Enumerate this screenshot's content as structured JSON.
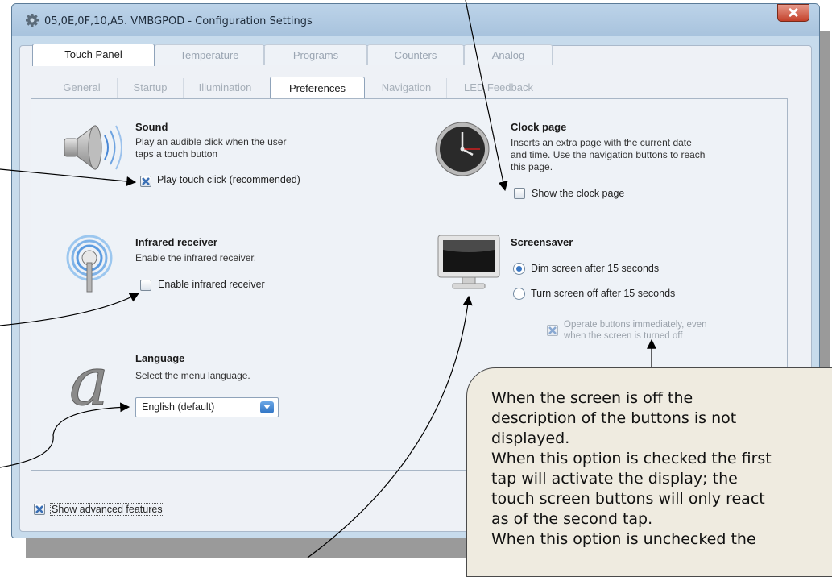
{
  "window": {
    "title": "05,0E,0F,10,A5. VMBGPOD - Configuration Settings"
  },
  "tabs": [
    {
      "label": "Touch Panel",
      "active": true
    },
    {
      "label": "Temperature",
      "active": false
    },
    {
      "label": "Programs",
      "active": false
    },
    {
      "label": "Counters",
      "active": false
    },
    {
      "label": "Analog",
      "active": false
    }
  ],
  "subtabs": [
    {
      "label": "General",
      "active": false
    },
    {
      "label": "Startup",
      "active": false
    },
    {
      "label": "Illumination",
      "active": false
    },
    {
      "label": "Preferences",
      "active": true
    },
    {
      "label": "Navigation",
      "active": false
    },
    {
      "label": "LED Feedback",
      "active": false
    }
  ],
  "sound": {
    "heading": "Sound",
    "description_line1": "Play an audible click when the user",
    "description_line2": "taps a touch button",
    "checkbox_label": "Play touch click (recommended)",
    "checked": true
  },
  "infrared": {
    "heading": "Infrared receiver",
    "description": "Enable the infrared receiver.",
    "checkbox_label": "Enable infrared receiver",
    "checked": false
  },
  "language": {
    "heading": "Language",
    "description": "Select the menu language.",
    "selected": "English (default)"
  },
  "clock": {
    "heading": "Clock page",
    "description_line1": "Inserts an extra page with the current date",
    "description_line2": "and time. Use the navigation buttons to reach",
    "description_line3": "this page.",
    "checkbox_label": "Show the clock page",
    "checked": false
  },
  "screensaver": {
    "heading": "Screensaver",
    "option_dim": "Dim screen after 15 seconds",
    "option_off": "Turn screen off after 15 seconds",
    "selected": "dim",
    "operate_line1": "Operate buttons immediately, even",
    "operate_line2": "when the screen is turned off",
    "operate_checked": true
  },
  "footer": {
    "advanced_label": "Show advanced features",
    "advanced_checked": true
  },
  "callout": {
    "text": "When the screen is off the\ndescription of the buttons is not\ndisplayed.\nWhen this option is checked the first\ntap will activate the display; the\ntouch screen buttons will only react\nas of the second tap.\nWhen this option is unchecked the"
  },
  "colors": {
    "accent": "#3b78c3",
    "callout_bg": "#efebe0",
    "close_button": "#c3402a"
  }
}
